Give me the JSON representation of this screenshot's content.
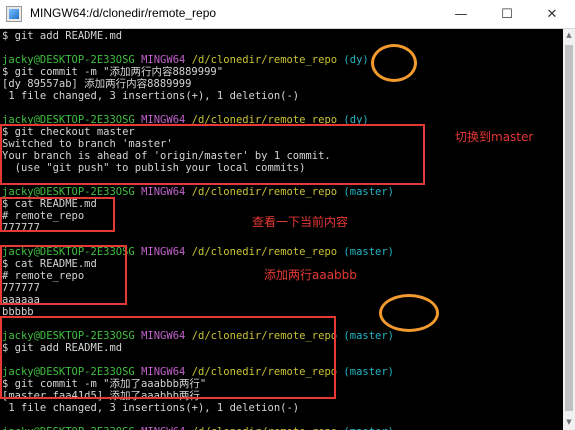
{
  "window": {
    "title": "MINGW64:/d/clonedir/remote_repo",
    "minimize": "—",
    "maximize": "☐",
    "close": "✕"
  },
  "prompt": {
    "user": "jacky@DESKTOP-2E33OSG",
    "env": "MINGW64",
    "path": "/d/clonedir/remote_repo"
  },
  "lines": [
    {
      "text": "$ git add README.md"
    },
    {
      "text": ""
    },
    {
      "prompt": true,
      "branch": "(dy)"
    },
    {
      "text": "$ git commit -m \"添加两行内容8889999\""
    },
    {
      "text": "[dy 89557ab] 添加两行内容8889999"
    },
    {
      "text": " 1 file changed, 3 insertions(+), 1 deletion(-)"
    },
    {
      "text": ""
    },
    {
      "prompt": true,
      "branch": "(dy)"
    },
    {
      "text": "$ git checkout master"
    },
    {
      "text": "Switched to branch 'master'"
    },
    {
      "text": "Your branch is ahead of 'origin/master' by 1 commit."
    },
    {
      "text": "  (use \"git push\" to publish your local commits)"
    },
    {
      "text": ""
    },
    {
      "prompt": true,
      "branch": "(master)"
    },
    {
      "text": "$ cat README.md"
    },
    {
      "text": "# remote_repo"
    },
    {
      "text": "777777"
    },
    {
      "text": ""
    },
    {
      "prompt": true,
      "branch": "(master)"
    },
    {
      "text": "$ cat README.md"
    },
    {
      "text": "# remote_repo"
    },
    {
      "text": "777777"
    },
    {
      "text": "aaaaaa"
    },
    {
      "text": "bbbbb"
    },
    {
      "text": ""
    },
    {
      "prompt": true,
      "branch": "(master)"
    },
    {
      "text": "$ git add README.md"
    },
    {
      "text": ""
    },
    {
      "prompt": true,
      "branch": "(master)"
    },
    {
      "text": "$ git commit -m \"添加了aaabbb两行\""
    },
    {
      "text": "[master faa41d5] 添加了aaabbb两行"
    },
    {
      "text": " 1 file changed, 3 insertions(+), 1 deletion(-)"
    },
    {
      "text": ""
    },
    {
      "prompt": true,
      "branch": "(master)"
    },
    {
      "text": "$ "
    }
  ],
  "annotations": {
    "switch_to_master": "切换到master",
    "view_current_content": "查看一下当前内容",
    "add_two_lines": "添加两行aaabbb"
  },
  "colors": {
    "prompt_user": "#3fbf3f",
    "prompt_env": "#c061cb",
    "prompt_path": "#c9c236",
    "prompt_branch": "#22b4c4",
    "annotation": "#e53935",
    "highlight_circle": "#f29a2e"
  }
}
